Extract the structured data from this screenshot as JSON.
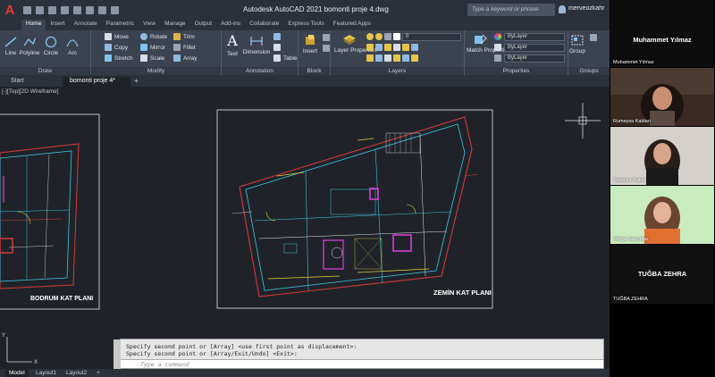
{
  "titlebar": {
    "app_title": "Autodesk AutoCAD 2021    bomonti proje 4.dwg",
    "search_placeholder": "Type a keyword or phrase",
    "user": "merveozkahr"
  },
  "ribbon_tabs": [
    "Home",
    "Insert",
    "Annotate",
    "Parametric",
    "View",
    "Manage",
    "Output",
    "Add-ins",
    "Collaborate",
    "Express Tools",
    "Featured Apps"
  ],
  "ribbon": {
    "draw": {
      "label": "Draw",
      "tools": [
        "Line",
        "Polyline",
        "Circle",
        "Arc"
      ]
    },
    "modify": {
      "label": "Modify",
      "tools": [
        "Move",
        "Rotate",
        "Trim",
        "Copy",
        "Mirror",
        "Fillet",
        "Stretch",
        "Scale",
        "Array"
      ]
    },
    "annotation": {
      "label": "Annotation",
      "tools": [
        "Text",
        "Dimension",
        "Table"
      ]
    },
    "block": {
      "label": "Block",
      "tools": [
        "Insert"
      ]
    },
    "layers": {
      "label": "Layers",
      "tools": [
        "Layer Properties"
      ],
      "current_layer": "0"
    },
    "properties": {
      "label": "Properties",
      "tools": [
        "Match Properties"
      ],
      "bylayer": [
        "ByLayer",
        "ByLayer",
        "ByLayer"
      ]
    },
    "groups": {
      "label": "Groups",
      "tools": [
        "Group"
      ]
    }
  },
  "file_tabs": [
    "Start",
    "bomonti proje 4*"
  ],
  "viewport_label": "[-][Top][2D Wireframe]",
  "drawings": {
    "left_label": "BODRUM KAT PLANI",
    "right_label": "ZEMİN KAT PLANI"
  },
  "command_line": {
    "history": [
      "Specify second point or [Array] <use first point as displacement>:",
      "Specify second point or [Array/Exit/Undo] <Exit>:"
    ],
    "placeholder": "Type a command"
  },
  "layout_tabs": [
    "Model",
    "Layout1",
    "Layout2"
  ],
  "participants": [
    {
      "name": "Muhammet Yılmaz",
      "display": "Muhammet Yılmaz",
      "type": "text"
    },
    {
      "name": "Rumeysa Kablan",
      "type": "video"
    },
    {
      "name": "Sananur Kukul",
      "type": "video"
    },
    {
      "name": "Simge Sarıçmar",
      "type": "video"
    },
    {
      "name": "TUĞBA ZEHRA",
      "display": "TUĞBA ZEHRA",
      "type": "text"
    }
  ],
  "colors": {
    "accent": "#0696d7",
    "wall_red": "#d23a3a",
    "wall_cyan": "#3ec6e0",
    "magenta": "#e040e0",
    "yellow": "#e6d23c"
  }
}
